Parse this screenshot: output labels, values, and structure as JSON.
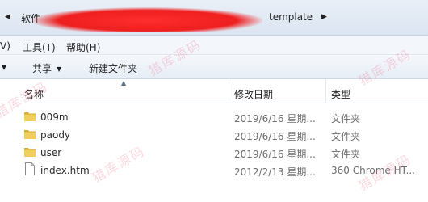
{
  "address": {
    "crumbs": [
      "软件",
      "template"
    ]
  },
  "menu": [
    "V)",
    "工具(T)",
    "帮助(H)"
  ],
  "toolbar": {
    "share_label": "共享",
    "new_folder_label": "新建文件夹"
  },
  "columns": {
    "name": "名称",
    "modified": "修改日期",
    "type": "类型"
  },
  "rows": [
    {
      "name": "009m",
      "modified": "2019/6/16 星期...",
      "type": "文件夹",
      "icon": "folder-icon"
    },
    {
      "name": "paody",
      "modified": "2019/6/16 星期...",
      "type": "文件夹",
      "icon": "folder-icon"
    },
    {
      "name": "user",
      "modified": "2019/6/16 星期...",
      "type": "文件夹",
      "icon": "folder-icon"
    },
    {
      "name": "index.htm",
      "modified": "2012/2/13 星期...",
      "type": "360 Chrome HT...",
      "icon": "html-file-icon"
    }
  ],
  "watermark": {
    "text": "猎库源码"
  },
  "colors": {
    "folder": "#e8c04a",
    "redaction": "#ef1f1f",
    "watermark": "#eb506e"
  }
}
